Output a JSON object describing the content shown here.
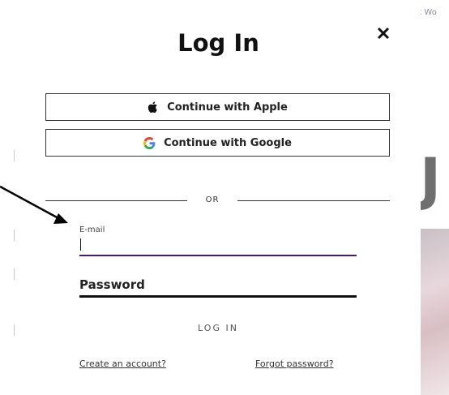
{
  "background": {
    "top_right_text": "· It Wo",
    "partial_letter": "J"
  },
  "modal": {
    "title": "Log In",
    "close_icon": "close-icon",
    "apple_button_label": "Continue with Apple",
    "google_button_label": "Continue with Google",
    "divider_text": "OR",
    "email_label": "E-mail",
    "email_value": "",
    "password_label": "Password",
    "password_value": "",
    "login_button_label": "LOG IN",
    "create_account_link": "Create an account?",
    "forgot_password_link": "Forgot password?"
  },
  "colors": {
    "email_underline": "#4a1a6e",
    "password_underline": "#111111",
    "annotation_arrow": "#000000"
  }
}
